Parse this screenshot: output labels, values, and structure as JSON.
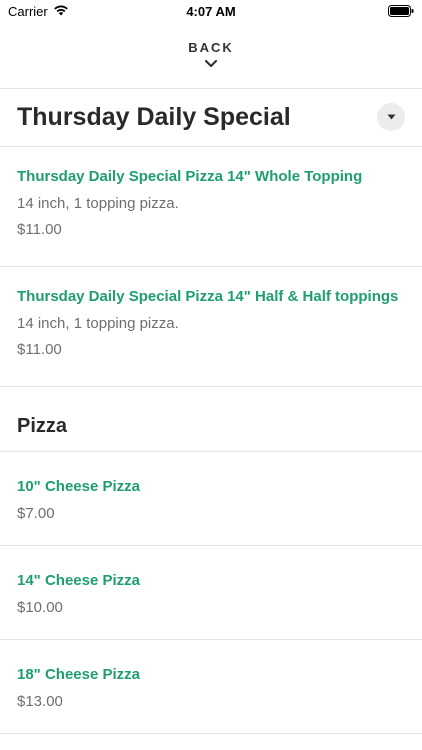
{
  "status_bar": {
    "carrier": "Carrier",
    "time": "4:07 AM"
  },
  "nav": {
    "back_label": "BACK",
    "back_icon": "chevron-down-icon"
  },
  "sections": [
    {
      "title": "Thursday Daily Special",
      "toggle_icon": "caret-down-icon",
      "items": [
        {
          "name": "Thursday Daily Special Pizza 14\" Whole Topping",
          "description": "14 inch, 1 topping pizza.",
          "price": "$11.00"
        },
        {
          "name": "Thursday Daily Special Pizza 14\" Half & Half toppings",
          "description": "14 inch, 1 topping pizza.",
          "price": "$11.00"
        }
      ]
    },
    {
      "title": "Pizza",
      "items": [
        {
          "name": "10\" Cheese Pizza",
          "price": "$7.00"
        },
        {
          "name": "14\" Cheese Pizza",
          "price": "$10.00"
        },
        {
          "name": "18\" Cheese Pizza",
          "price": "$13.00"
        }
      ]
    }
  ],
  "colors": {
    "item_name": "#1f9e6e",
    "secondary_text": "#6f6f6f",
    "divider": "#e4e4e4"
  }
}
